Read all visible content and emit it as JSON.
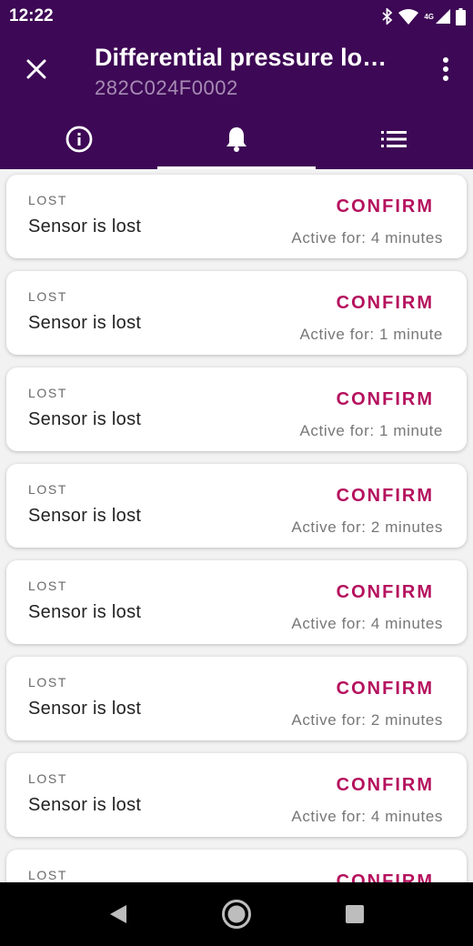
{
  "status_bar": {
    "time": "12:22",
    "network": "4G"
  },
  "app_bar": {
    "title": "Differential pressure lo…",
    "subtitle": "282C024F0002"
  },
  "tabs": [
    {
      "icon": "info-icon",
      "active": false
    },
    {
      "icon": "bell-icon",
      "active": true
    },
    {
      "icon": "list-icon",
      "active": false
    }
  ],
  "alarms": [
    {
      "category": "LOST",
      "message": "Sensor is lost",
      "action": "CONFIRM",
      "active_for": "Active for: 4 minutes"
    },
    {
      "category": "LOST",
      "message": "Sensor is lost",
      "action": "CONFIRM",
      "active_for": "Active for: 1 minute"
    },
    {
      "category": "LOST",
      "message": "Sensor is lost",
      "action": "CONFIRM",
      "active_for": "Active for: 1 minute"
    },
    {
      "category": "LOST",
      "message": "Sensor is lost",
      "action": "CONFIRM",
      "active_for": "Active for: 2 minutes"
    },
    {
      "category": "LOST",
      "message": "Sensor is lost",
      "action": "CONFIRM",
      "active_for": "Active for: 4 minutes"
    },
    {
      "category": "LOST",
      "message": "Sensor is lost",
      "action": "CONFIRM",
      "active_for": "Active for: 2 minutes"
    },
    {
      "category": "LOST",
      "message": "Sensor is lost",
      "action": "CONFIRM",
      "active_for": "Active for: 4 minutes"
    },
    {
      "category": "LOST",
      "message": "",
      "action": "CONFIRM",
      "active_for": ""
    }
  ],
  "colors": {
    "primary": "#3d0855",
    "accent": "#b5115e"
  }
}
